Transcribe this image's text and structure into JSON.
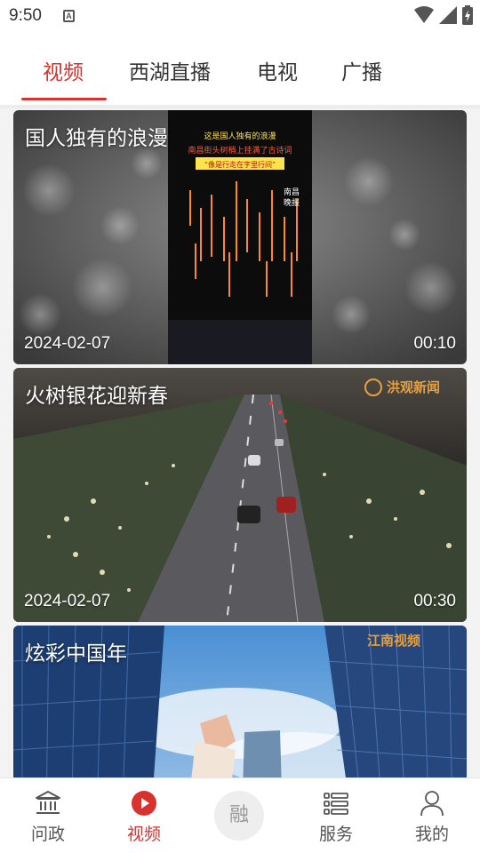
{
  "status_bar": {
    "time": "9:50",
    "notif_letter": "A"
  },
  "tabs": [
    {
      "label": "视频",
      "active": true
    },
    {
      "label": "西湖直播",
      "active": false
    },
    {
      "label": "电视",
      "active": false
    },
    {
      "label": "广播",
      "active": false
    }
  ],
  "videos": [
    {
      "title": "国人独有的浪漫",
      "date": "2024-02-07",
      "duration": "00:10",
      "overlay_lines": [
        "这是国人独有的浪漫",
        "南昌街头树梢上挂满了古诗词",
        "“像是行走在字里行间”",
        "南昌",
        "晚报"
      ]
    },
    {
      "title": "火树银花迎新春",
      "date": "2024-02-07",
      "duration": "00:30",
      "watermark": "洪观新闻"
    },
    {
      "title": "炫彩中国年",
      "watermark": "江南视频"
    }
  ],
  "bottom_nav": [
    {
      "label": "问政",
      "icon": "government-building-icon",
      "active": false
    },
    {
      "label": "视频",
      "icon": "play-circle-icon",
      "active": true
    },
    {
      "label": "融",
      "icon": "rong-center-icon",
      "active": false
    },
    {
      "label": "服务",
      "icon": "list-icon",
      "active": false
    },
    {
      "label": "我的",
      "icon": "person-icon",
      "active": false
    }
  ],
  "colors": {
    "accent": "#d7322d",
    "text": "#333333",
    "nav_text": "#555555"
  }
}
